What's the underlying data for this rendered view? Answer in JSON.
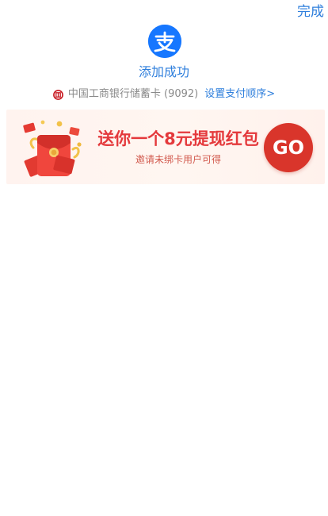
{
  "header": {
    "done_label": "完成"
  },
  "result": {
    "logo_icon": "alipay-logo-icon",
    "success_text": "添加成功",
    "bank_icon": "icbc-bank-icon",
    "bank_name": "中国工商银行储蓄卡 (9092)",
    "set_order_link": "设置支付顺序>"
  },
  "promo": {
    "title": "送你一个8元提现红包",
    "subtitle": "邀请未绑卡用户可得",
    "go_label": "GO",
    "illustration": "red-envelope-illustration"
  },
  "colors": {
    "link_blue": "#2f7fdc",
    "alipay_blue": "#1677ff",
    "promo_red": "#e4393c",
    "go_button_red": "#d9352b",
    "promo_background": "#fff4ef"
  }
}
